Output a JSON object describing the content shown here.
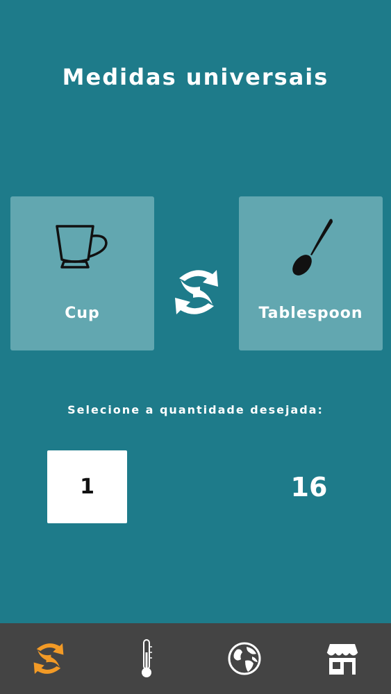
{
  "header": {
    "title": "Medidas universais"
  },
  "converter": {
    "from_unit": {
      "label": "Cup",
      "icon": "cup-icon"
    },
    "to_unit": {
      "label": "Tablespoon",
      "icon": "spoon-icon"
    },
    "swap_icon": "swap-arrows-icon",
    "prompt": "Selecione a quantidade desejada:",
    "quantity_value": "1",
    "result_value": "16"
  },
  "bottom_nav": {
    "items": [
      {
        "icon": "convert-icon",
        "active": true
      },
      {
        "icon": "thermometer-icon",
        "active": false
      },
      {
        "icon": "globe-icon",
        "active": false
      },
      {
        "icon": "store-icon",
        "active": false
      }
    ]
  },
  "colors": {
    "background": "#1e7b8a",
    "card": "#62a7b0",
    "nav_background": "#444444",
    "active_accent": "#f29a26",
    "icon_white": "#ffffff"
  }
}
